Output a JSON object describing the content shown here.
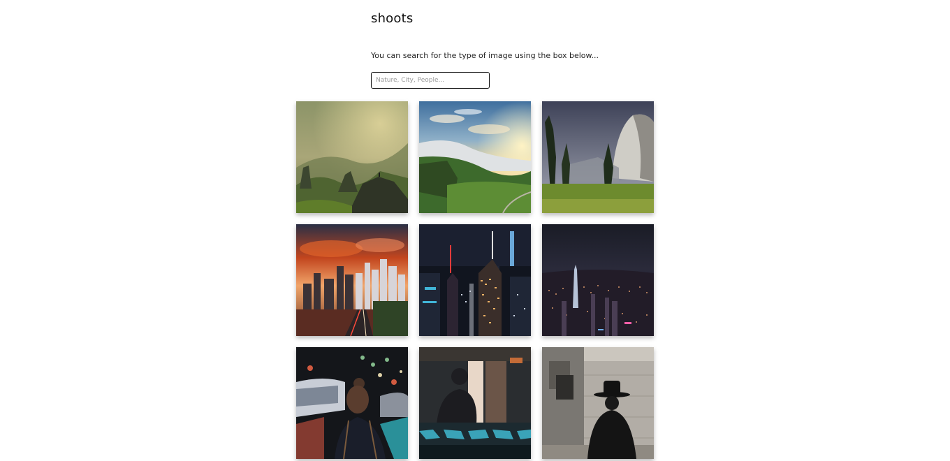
{
  "header": {
    "title": "shoots"
  },
  "search": {
    "intro": "You can search for the type of image using the box below...",
    "placeholder": "Nature, City, People...",
    "value": ""
  },
  "gallery": {
    "images": [
      {
        "category": "Nature",
        "subject": "hiker on rocky ridge above misty mountains"
      },
      {
        "category": "Nature",
        "subject": "green highland valley with clouds at sunrise"
      },
      {
        "category": "Nature",
        "subject": "granite cliff with pine trees and meadow"
      },
      {
        "category": "City",
        "subject": "skyline at sunset with highway"
      },
      {
        "category": "City",
        "subject": "illuminated skyscrapers at night"
      },
      {
        "category": "City",
        "subject": "aerial city lights at night"
      },
      {
        "category": "People",
        "subject": "woman with bun on night street with bokeh"
      },
      {
        "category": "People",
        "subject": "man silhouette behind rainy window"
      },
      {
        "category": "People",
        "subject": "man in hat beside stone building"
      }
    ]
  },
  "colors": {
    "background": "#ffffff",
    "text": "#111111",
    "input_border": "#111111"
  }
}
